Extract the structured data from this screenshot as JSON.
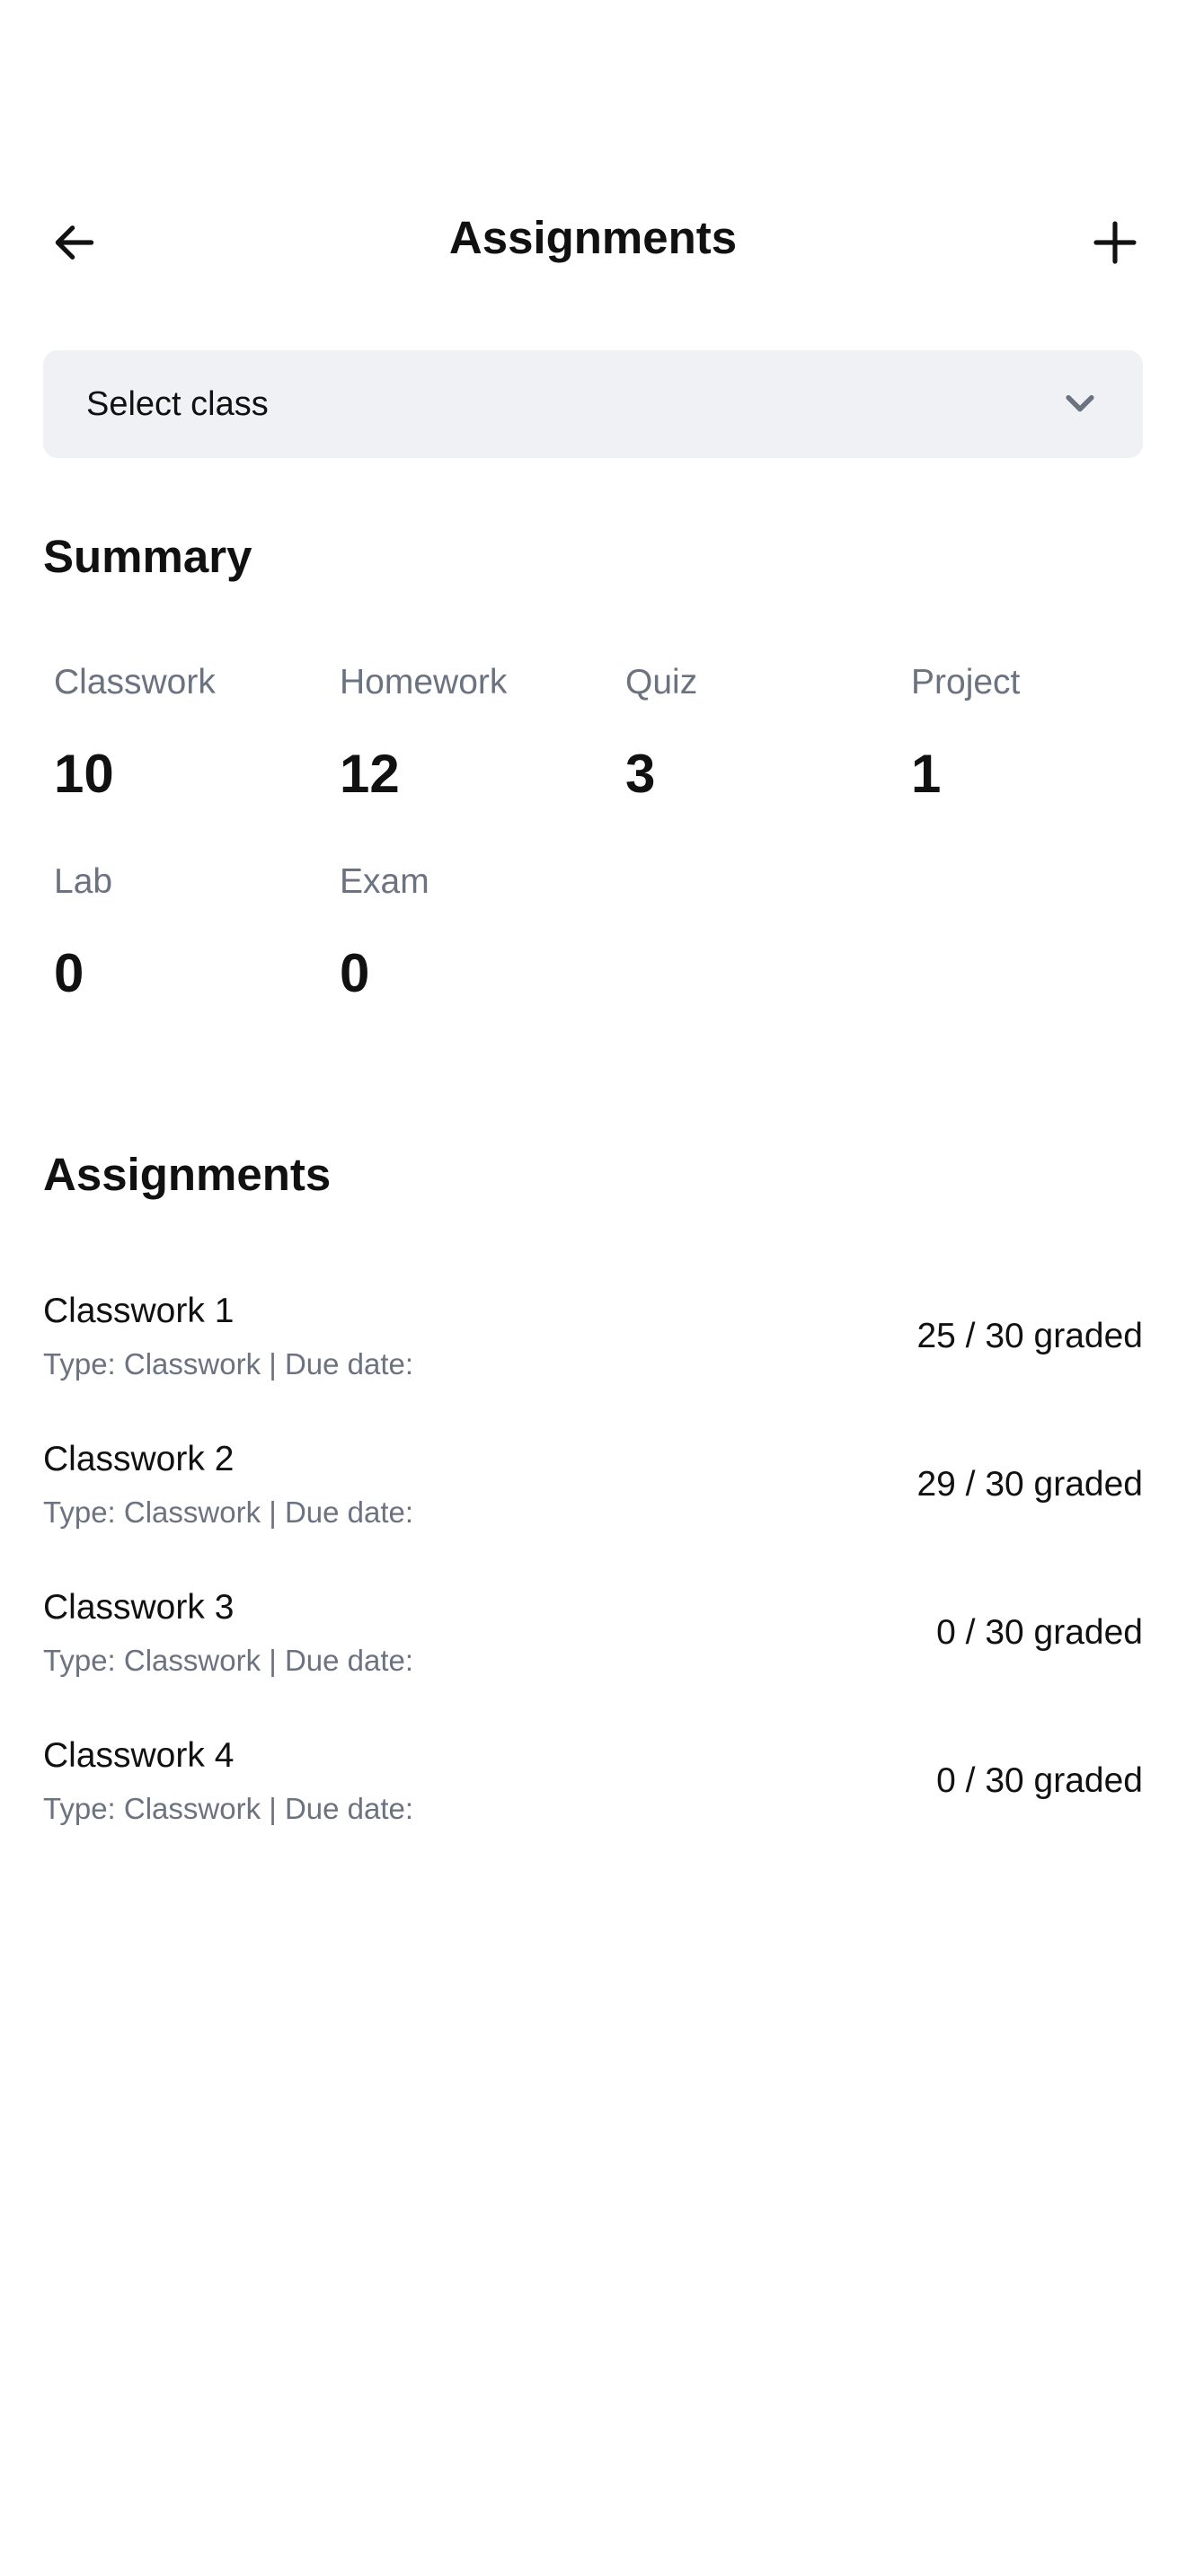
{
  "header": {
    "title": "Assignments",
    "back_icon": "arrow-left-icon",
    "add_icon": "plus-icon"
  },
  "class_select": {
    "value": "Select class",
    "icon": "chevron-down-icon"
  },
  "summary": {
    "title": "Summary",
    "stats": [
      {
        "label": "Classwork",
        "value": "10"
      },
      {
        "label": "Homework",
        "value": "12"
      },
      {
        "label": "Quiz",
        "value": "3"
      },
      {
        "label": "Project",
        "value": "1"
      },
      {
        "label": "Lab",
        "value": "0"
      },
      {
        "label": "Exam",
        "value": "0"
      }
    ]
  },
  "assignments": {
    "title": "Assignments",
    "items": [
      {
        "name": "Classwork 1",
        "meta": "Type: Classwork | Due date:",
        "graded": "25 / 30 graded"
      },
      {
        "name": "Classwork 2",
        "meta": "Type: Classwork | Due date:",
        "graded": "29 / 30 graded"
      },
      {
        "name": "Classwork 3",
        "meta": "Type: Classwork | Due date:",
        "graded": "0 / 30 graded"
      },
      {
        "name": "Classwork 4",
        "meta": "Type: Classwork | Due date:",
        "graded": "0 / 30 graded"
      }
    ]
  },
  "colors": {
    "text": "#111111",
    "muted": "#6b7280",
    "select_bg": "#f0f1f4"
  }
}
